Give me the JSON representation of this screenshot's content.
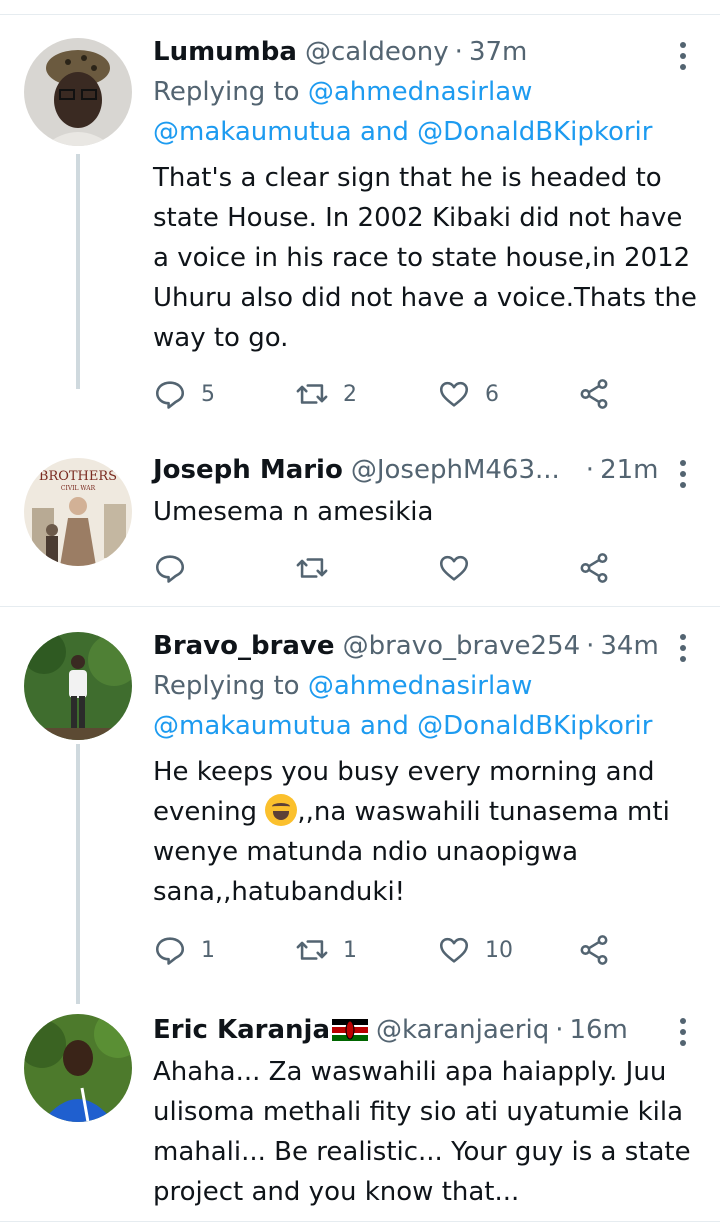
{
  "tweets": [
    {
      "name": "Lumumba",
      "handle": "@caldeony",
      "time": "37m",
      "reply_prefix": "Replying to",
      "reply_line1": "@ahmednasirlaw",
      "reply_line2a": "@makaumutua",
      "reply_and": "and",
      "reply_line2b": "@DonaldBKipkorir",
      "text": "That's a clear sign that he is headed to state House. In 2002 Kibaki did not have a voice in his race to state house,in 2012 Uhuru also did not have a voice.Thats the way to go.",
      "replies": "5",
      "retweets": "2",
      "likes": "6"
    },
    {
      "name": "Joseph Mario",
      "handle": "@JosephM463...",
      "time": "21m",
      "text": "Umesema n amesikia",
      "avatar_text_1": "BROTHERS",
      "avatar_text_2": "CIVIL WAR"
    },
    {
      "name": "Bravo_brave",
      "handle": "@bravo_brave254",
      "time": "34m",
      "reply_prefix": "Replying to",
      "reply_line1": "@ahmednasirlaw",
      "reply_line2a": "@makaumutua",
      "reply_and": "and",
      "reply_line2b": "@DonaldBKipkorir",
      "text_before_emoji": "He keeps you busy every morning and evening",
      "text_after_emoji": ",,na waswahili tunasema mti wenye matunda ndio unaopigwa sana,,hatubanduki!",
      "replies": "1",
      "retweets": "1",
      "likes": "10"
    },
    {
      "name": "Eric Karanja",
      "handle": "@karanjaeriq",
      "time": "16m",
      "text": "Ahaha... Za waswahili apa haiapply. Juu ulisoma methali fity sio ati uyatumie kila mahali... Be realistic... Your guy is a state project and you know that..."
    }
  ],
  "icons": [
    "reply-icon",
    "retweet-icon",
    "like-icon",
    "share-icon",
    "more-icon",
    "kenya-flag-icon",
    "rofl-emoji-icon"
  ],
  "colors": {
    "link": "#1d9bf0",
    "muted": "#536471",
    "text": "#0f1419",
    "thread": "#cfd9de",
    "divider": "#e6ecf0"
  }
}
